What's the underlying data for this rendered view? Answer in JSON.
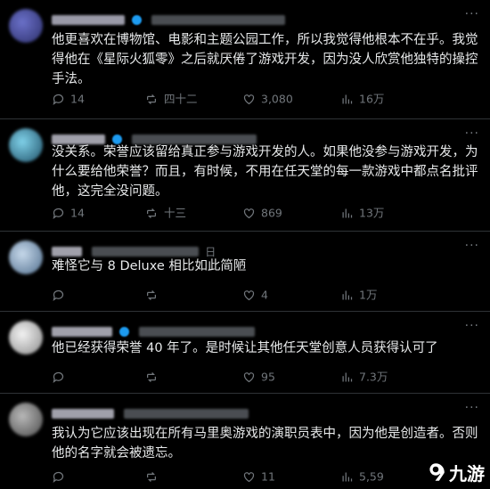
{
  "posts": [
    {
      "text": "他更喜欢在博物馆、电影和主题公园工作，所以我觉得他根本不在乎。我觉得他在《星际火狐零》之后就厌倦了游戏开发，因为没人欣赏他独特的操控手法。",
      "date": "",
      "avatar_color": "#4a4f9c",
      "stats": {
        "replies": "14",
        "reposts": "四十二",
        "likes": "3,080",
        "views": "16万"
      }
    },
    {
      "text": "没关系。荣誉应该留给真正参与游戏开发的人。如果他没参与游戏开发，为什么要给他荣誉？而且，有时候，不用在任天堂的每一款游戏中都点名批评他，这完全没问题。",
      "date": "",
      "avatar_color": "#3b8aa8",
      "stats": {
        "replies": "14",
        "reposts": "十三",
        "likes": "869",
        "views": "13万"
      }
    },
    {
      "text": "难怪它与 8 Deluxe 相比如此简陋",
      "date": "日",
      "avatar_color": "#8aa0b8",
      "stats": {
        "replies": "",
        "reposts": "",
        "likes": "4",
        "views": "1万"
      }
    },
    {
      "text": "他已经获得荣誉 40 年了。是时候让其他任天堂创意人员获得认可了",
      "date": "",
      "avatar_color": "#c9c9c9",
      "stats": {
        "replies": "",
        "reposts": "",
        "likes": "95",
        "views": "7.3万"
      }
    },
    {
      "text": "我认为它应该出现在所有马里奥游戏的演职员表中，因为他是创造者。否则他的名字就会被遗忘。",
      "date": "",
      "avatar_color": "#8f8f8f",
      "stats": {
        "replies": "",
        "reposts": "",
        "likes": "11",
        "views": "5,59"
      }
    }
  ],
  "watermark": {
    "text": "九游",
    "icon": "nine-game-logo"
  },
  "colors": {
    "background": "#000000",
    "text": "#e7e9ea",
    "muted": "#71767b",
    "verified": "#1d9bf0",
    "divider": "#2f3336"
  }
}
